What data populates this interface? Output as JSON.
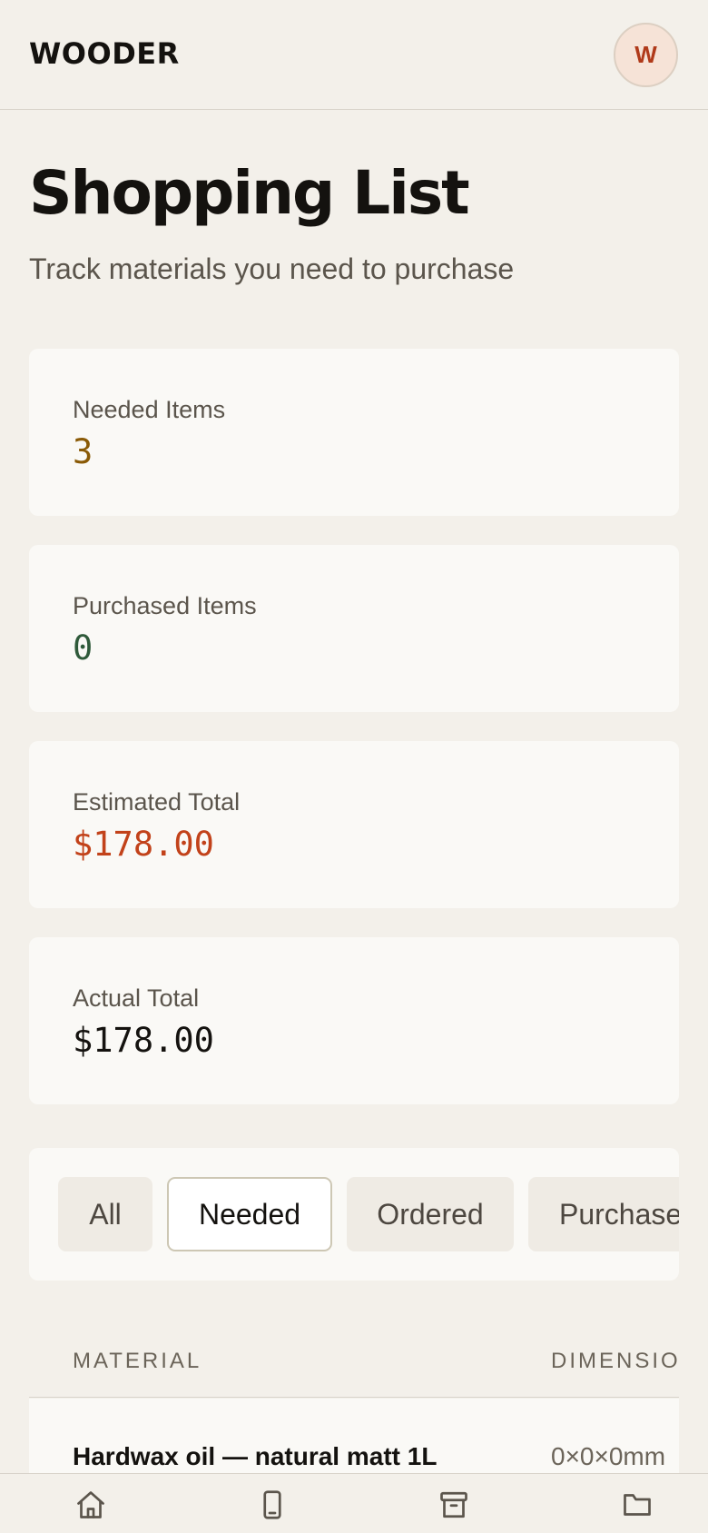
{
  "app": {
    "brand": "WOODER",
    "avatar_initial": "W"
  },
  "page": {
    "title": "Shopping List",
    "subtitle": "Track materials you need to purchase"
  },
  "stats": {
    "needed": {
      "label": "Needed Items",
      "value": "3",
      "color": "#8a5a06"
    },
    "purchased": {
      "label": "Purchased Items",
      "value": "0",
      "color": "#2f5a3a"
    },
    "estimated": {
      "label": "Estimated Total",
      "value": "$178.00",
      "color": "#c2421a"
    },
    "actual": {
      "label": "Actual Total",
      "value": "$178.00",
      "color": "#14120f"
    }
  },
  "filters": {
    "active": "Needed",
    "items": [
      "All",
      "Needed",
      "Ordered",
      "Purchased"
    ]
  },
  "table": {
    "columns": [
      "MATERIAL",
      "DIMENSION"
    ],
    "rows": [
      {
        "material": "Hardwax oil — natural matt 1L",
        "dimensions": "0×0×0mm"
      }
    ]
  },
  "bottom_nav": {
    "items": [
      "home-icon",
      "phone-icon",
      "archive-icon",
      "folder-icon"
    ]
  }
}
